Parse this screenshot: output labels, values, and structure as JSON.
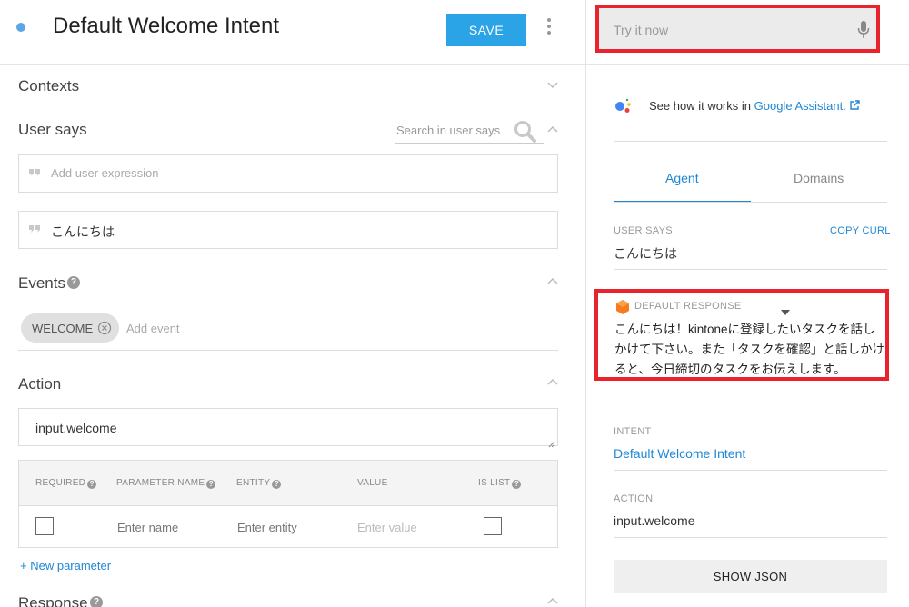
{
  "header": {
    "intent_title": "Default Welcome Intent",
    "save_label": "SAVE"
  },
  "contexts": {
    "title": "Contexts"
  },
  "user_says": {
    "title": "User says",
    "search_placeholder": "Search in user says",
    "add_expression_placeholder": "Add user expression",
    "expressions": [
      "こんにちは"
    ]
  },
  "events": {
    "title": "Events",
    "chips": [
      "WELCOME"
    ],
    "add_placeholder": "Add event"
  },
  "action": {
    "title": "Action",
    "value": "input.welcome",
    "parameters": {
      "headers": [
        "REQUIRED",
        "PARAMETER NAME",
        "ENTITY",
        "VALUE",
        "IS LIST"
      ],
      "row": {
        "name_placeholder": "Enter name",
        "entity_placeholder": "Enter entity",
        "value_placeholder": "Enter value"
      }
    },
    "new_parameter_label": "New parameter"
  },
  "response": {
    "title": "Response"
  },
  "console": {
    "try_placeholder": "Try it now",
    "ga_prefix": "See how it works in",
    "ga_link": "Google Assistant.",
    "tabs": [
      "Agent",
      "Domains"
    ],
    "active_tab": "Agent",
    "user_says_label": "USER SAYS",
    "copy_curl_label": "COPY CURL",
    "user_says_value": "こんにちは",
    "default_response_label": "DEFAULT RESPONSE",
    "default_response_text": "こんにちは！kintoneに登録したいタスクを話しかけて下さい。また「タスクを確認」と話しかけると、今日締切のタスクをお伝えします。",
    "intent_label": "INTENT",
    "intent_value": "Default Welcome Intent",
    "action_label": "ACTION",
    "action_value": "input.welcome",
    "show_json_label": "SHOW JSON"
  },
  "colors": {
    "accent_blue": "#1f87d3",
    "save_button": "#2aa4e6",
    "highlight_red": "#e9232b",
    "response_icon": "#f57c1f"
  },
  "icons": [
    "search-icon",
    "quote-icon",
    "help-icon",
    "close-circle-icon",
    "chevron-up-icon",
    "chevron-down-icon",
    "mic-icon",
    "google-assistant-icon",
    "external-link-icon",
    "kebab-menu-icon",
    "dropdown-caret-icon"
  ]
}
